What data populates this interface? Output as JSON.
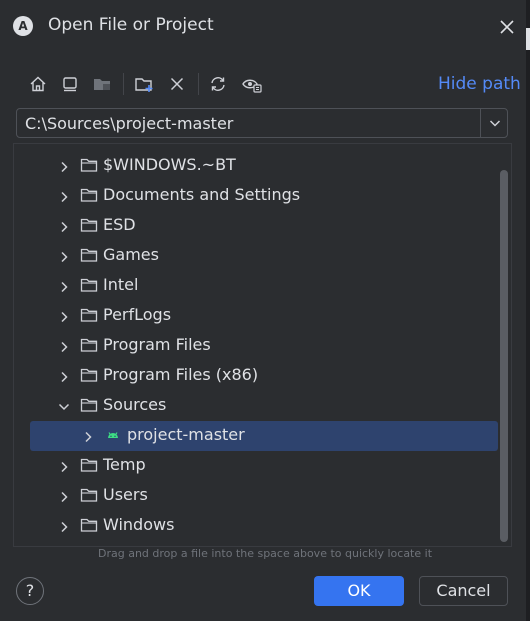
{
  "window": {
    "title": "Open File or Project",
    "logo_glyph": "A"
  },
  "toolbar": {
    "icons": [
      "home-icon",
      "desktop-icon",
      "project-folder-icon",
      "new-folder-icon",
      "delete-icon",
      "refresh-icon",
      "show-hidden-icon"
    ],
    "hide_path_label": "Hide path"
  },
  "path": {
    "value": "C:\\Sources\\project-master"
  },
  "tree": {
    "items": [
      {
        "label": "$WINDOWS.~BT",
        "expanded": false,
        "type": "folder"
      },
      {
        "label": "Documents and Settings",
        "expanded": false,
        "type": "folder"
      },
      {
        "label": "ESD",
        "expanded": false,
        "type": "folder"
      },
      {
        "label": "Games",
        "expanded": false,
        "type": "folder"
      },
      {
        "label": "Intel",
        "expanded": false,
        "type": "folder"
      },
      {
        "label": "PerfLogs",
        "expanded": false,
        "type": "folder"
      },
      {
        "label": "Program Files",
        "expanded": false,
        "type": "folder"
      },
      {
        "label": "Program Files (x86)",
        "expanded": false,
        "type": "folder"
      },
      {
        "label": "Sources",
        "expanded": true,
        "type": "folder"
      },
      {
        "label": "project-master",
        "expanded": false,
        "type": "android-project",
        "selected": true
      },
      {
        "label": "Temp",
        "expanded": false,
        "type": "folder"
      },
      {
        "label": "Users",
        "expanded": false,
        "type": "folder"
      },
      {
        "label": "Windows",
        "expanded": false,
        "type": "folder"
      }
    ]
  },
  "hint": "Drag and drop a file into the space above to quickly locate it",
  "buttons": {
    "help": "?",
    "ok": "OK",
    "cancel": "Cancel"
  },
  "colors": {
    "accent": "#3574f0",
    "link": "#548af7",
    "selection": "#2e436e",
    "android": "#3ddc84",
    "background": "#2b2d30"
  }
}
